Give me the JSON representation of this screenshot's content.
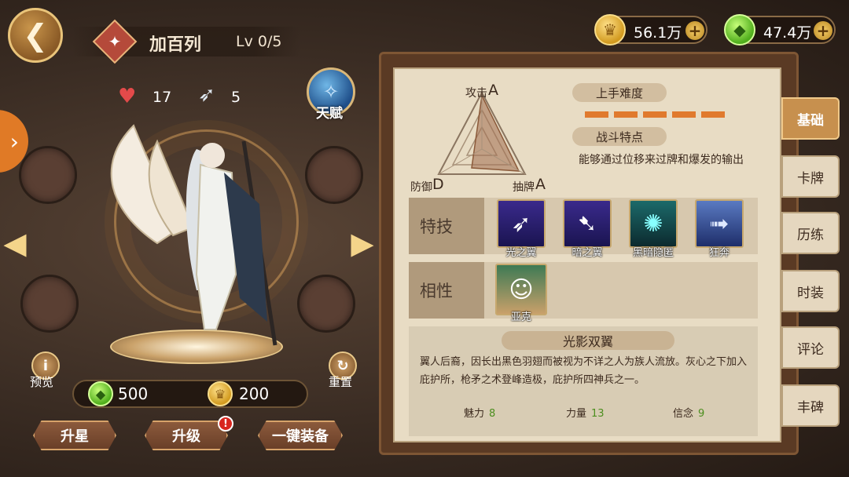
{
  "header": {
    "hero_name": "加百列",
    "hero_level": "Lv 0/5",
    "gold": "56.1万",
    "gems": "47.4万"
  },
  "hero": {
    "likes": "17",
    "wings": "5",
    "talent_label": "天赋",
    "preview_label": "预览",
    "reset_label": "重置",
    "resource_gem": "500",
    "resource_gold": "200",
    "buttons": {
      "star_up": "升星",
      "level_up": "升级",
      "auto_equip": "一键装备",
      "level_up_badge": "!"
    }
  },
  "panel": {
    "radar": {
      "attack_label": "攻击",
      "attack_grade": "A",
      "defense_label": "防御",
      "defense_grade": "D",
      "draw_label": "抽牌",
      "draw_grade": "A"
    },
    "difficulty_title": "上手难度",
    "difficulty_level": 5,
    "battle_feature_title": "战斗特点",
    "battle_feature_text": "能够通过位移来过牌和爆发的输出",
    "skills_label": "特技",
    "skills": [
      {
        "name": "光之翼",
        "icon": "wing-right-icon"
      },
      {
        "name": "暗之翼",
        "icon": "wing-left-icon"
      },
      {
        "name": "黑暗隐匿",
        "icon": "dark-stealth-icon"
      },
      {
        "name": "狂奔",
        "icon": "sprint-icon"
      }
    ],
    "affinity_label": "相性",
    "affinity": [
      {
        "name": "亚克",
        "icon": "portrait-icon"
      }
    ],
    "bio_title": "光影双翼",
    "bio_text": "翼人后裔，因长出黑色羽翅而被视为不详之人为族人流放。灰心之下加入庇护所，枪矛之术登峰造极，庇护所四神兵之一。",
    "attributes": [
      {
        "label": "魅力",
        "value": "8"
      },
      {
        "label": "力量",
        "value": "13"
      },
      {
        "label": "信念",
        "value": "9"
      }
    ]
  },
  "tabs": [
    "基础",
    "卡牌",
    "历练",
    "时装",
    "评论",
    "丰碑"
  ],
  "colors": {
    "accent": "#c7904e",
    "difficulty": "#e07a2e",
    "attr_value": "#4c8e1e"
  }
}
